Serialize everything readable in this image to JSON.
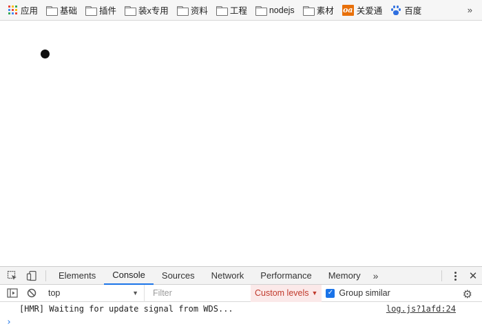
{
  "bookmarks": [
    {
      "label": "应用",
      "icon": "apps-grid-icon"
    },
    {
      "label": "基础",
      "icon": "folder-icon"
    },
    {
      "label": "插件",
      "icon": "folder-icon"
    },
    {
      "label": "装x专用",
      "icon": "folder-icon"
    },
    {
      "label": "资料",
      "icon": "folder-icon"
    },
    {
      "label": "工程",
      "icon": "folder-icon"
    },
    {
      "label": "nodejs",
      "icon": "folder-icon"
    },
    {
      "label": "素材",
      "icon": "folder-icon"
    },
    {
      "label": "关爱通",
      "icon": "oa-logo-icon",
      "logo_text": "oa"
    },
    {
      "label": "百度",
      "icon": "paw-icon"
    }
  ],
  "bookmarks_overflow": "»",
  "devtools": {
    "tabs": [
      {
        "label": "Elements",
        "active": false
      },
      {
        "label": "Console",
        "active": true
      },
      {
        "label": "Sources",
        "active": false
      },
      {
        "label": "Network",
        "active": false
      },
      {
        "label": "Performance",
        "active": false
      },
      {
        "label": "Memory",
        "active": false
      }
    ],
    "tabs_more": "»",
    "close_glyph": "✕",
    "context": "top",
    "filter_placeholder": "Filter",
    "levels_label": "Custom levels",
    "group_similar_label": "Group similar",
    "group_similar_checked": true,
    "console_messages": [
      {
        "text": "[HMR] Waiting for update signal from WDS...",
        "source": "log.js?1afd:24"
      }
    ],
    "prompt_glyph": "›"
  },
  "colors": {
    "accent": "#1a73e8",
    "levels_bg": "#fbe9e9",
    "levels_text": "#c0392b"
  }
}
